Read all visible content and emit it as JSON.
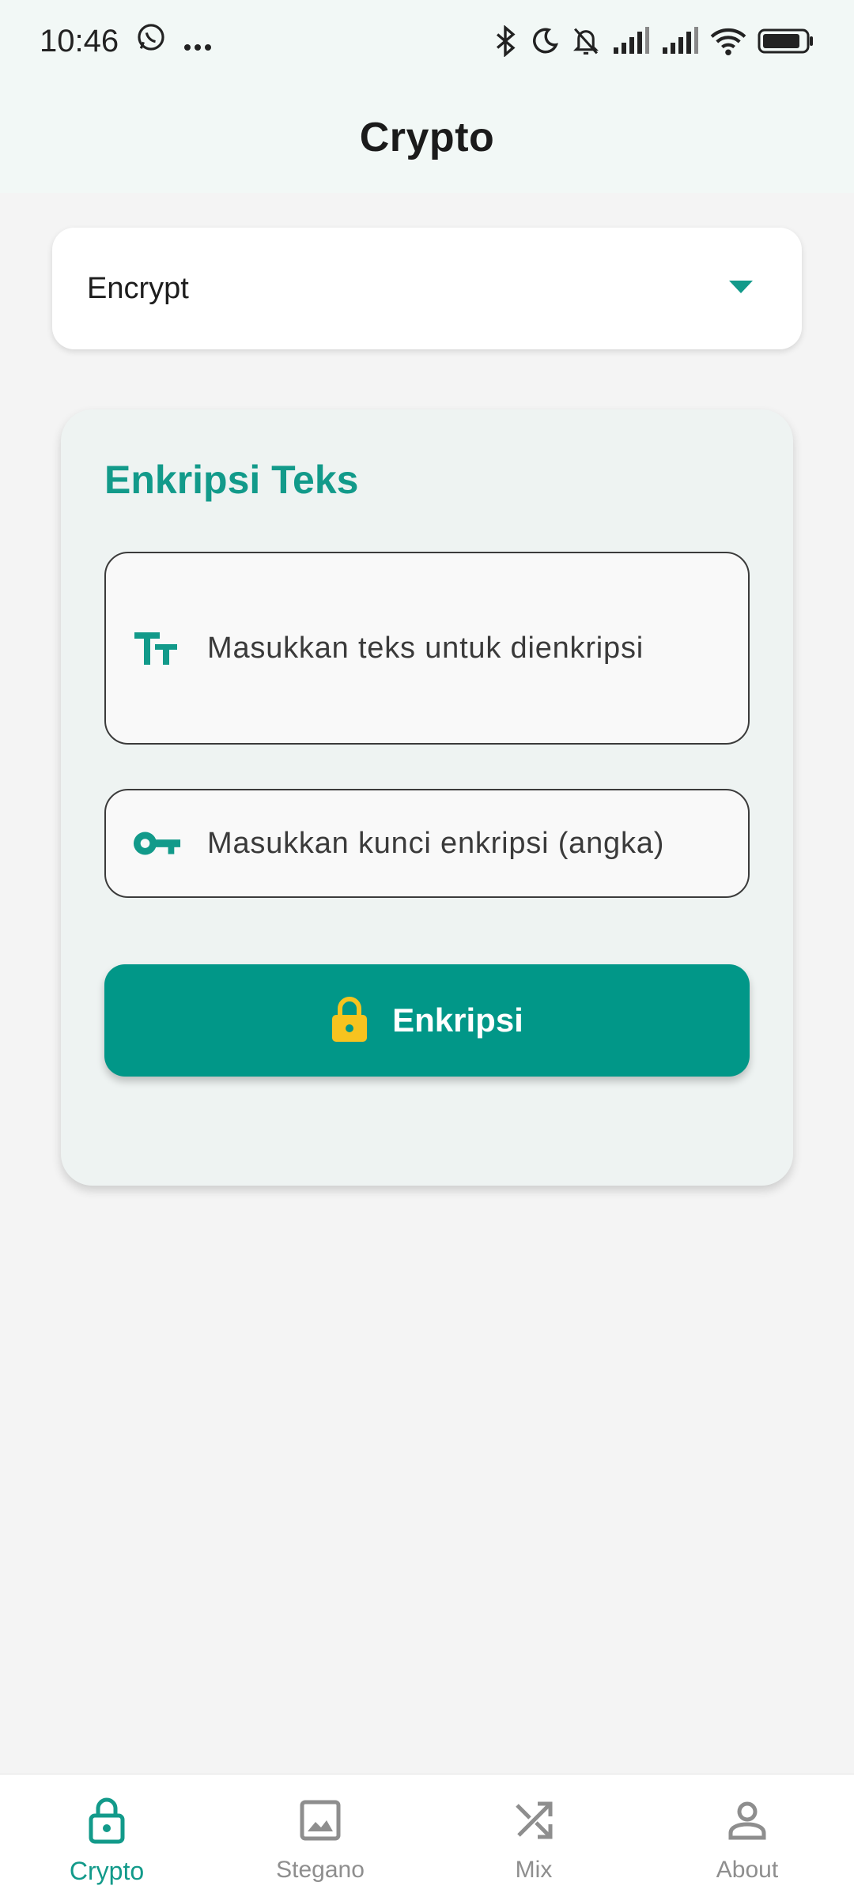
{
  "status_bar": {
    "time": "10:46",
    "icons": [
      "whatsapp-icon",
      "more-dots-icon",
      "bluetooth-icon",
      "moon-icon",
      "bell-off-icon",
      "signal-icon",
      "signal-icon",
      "wifi-icon",
      "battery-icon"
    ]
  },
  "app_bar": {
    "title": "Crypto"
  },
  "mode_dropdown": {
    "selected": "Encrypt",
    "icon": "caret-down-icon"
  },
  "card": {
    "title": "Enkripsi Teks",
    "text_input": {
      "placeholder": "Masukkan teks untuk dienkripsi",
      "value": "",
      "icon": "text-fields-icon"
    },
    "key_input": {
      "placeholder": "Masukkan kunci enkripsi (angka)",
      "value": "",
      "icon": "key-icon"
    },
    "button": {
      "label": "Enkripsi",
      "icon": "lock-icon"
    }
  },
  "bottom_nav": {
    "items": [
      {
        "label": "Crypto",
        "icon": "lock-icon",
        "active": true
      },
      {
        "label": "Stegano",
        "icon": "image-icon",
        "active": false
      },
      {
        "label": "Mix",
        "icon": "shuffle-icon",
        "active": false
      },
      {
        "label": "About",
        "icon": "person-icon",
        "active": false
      }
    ]
  },
  "colors": {
    "accent": "#019788",
    "accent_text": "#129a8a",
    "lock_yellow": "#f7c31f",
    "background": "#f4f4f4",
    "card_background": "#eef3f2",
    "inactive_nav": "#8e8e8e"
  }
}
